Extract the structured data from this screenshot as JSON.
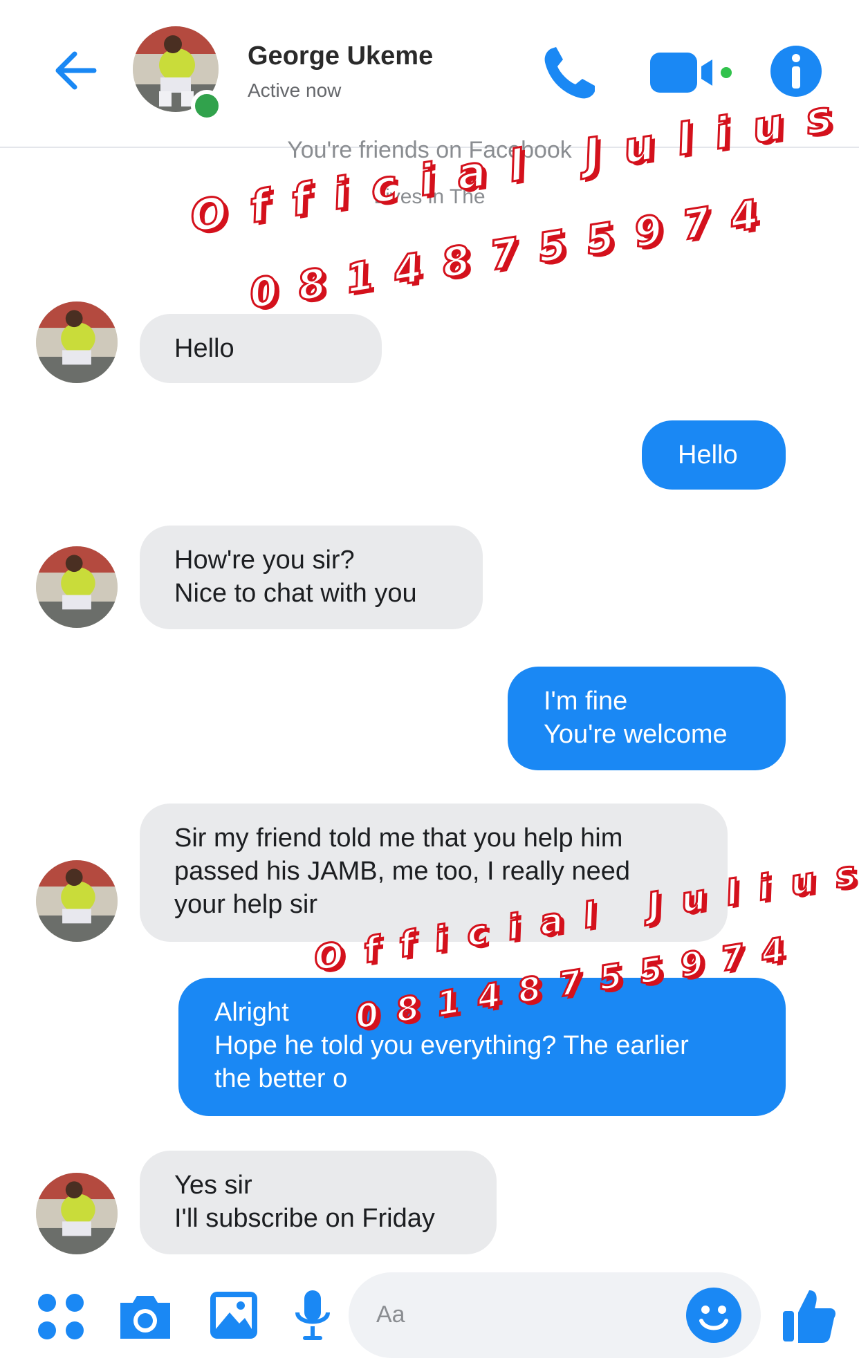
{
  "header": {
    "contact_name": "George Ukeme",
    "status": "Active now",
    "icons": [
      "back-arrow-icon",
      "phone-icon",
      "video-call-icon",
      "info-icon"
    ]
  },
  "system_notes": {
    "friends": "You're friends on Facebook",
    "lives_in": "Lives in The"
  },
  "messages": [
    {
      "from": "contact",
      "lines": [
        "Hello"
      ]
    },
    {
      "from": "me",
      "lines": [
        "Hello"
      ]
    },
    {
      "from": "contact",
      "lines": [
        "How're you sir?",
        "Nice to chat with you"
      ]
    },
    {
      "from": "me",
      "lines": [
        "I'm fine",
        "You're welcome"
      ]
    },
    {
      "from": "contact",
      "lines": [
        "Sir my friend told me that you help him",
        "passed his JAMB, me too, I really need",
        "your help sir"
      ]
    },
    {
      "from": "me",
      "lines": [
        "Alright",
        "Hope he told you everything? The earlier",
        "the better o"
      ]
    },
    {
      "from": "contact",
      "lines": [
        "Yes sir",
        "I'll subscribe on Friday"
      ]
    }
  ],
  "watermark": {
    "line1": "Official Julius",
    "line2": "08148755974"
  },
  "composer": {
    "placeholder": "Aa",
    "icons": [
      "apps-icon",
      "camera-icon",
      "gallery-icon",
      "microphone-icon",
      "emoji-icon",
      "thumbs-up-icon"
    ]
  },
  "colors": {
    "messenger_blue": "#1a88f4",
    "incoming_bubble": "#e9eaec",
    "watermark_red": "#d4111c",
    "online_green": "#31a24c"
  }
}
